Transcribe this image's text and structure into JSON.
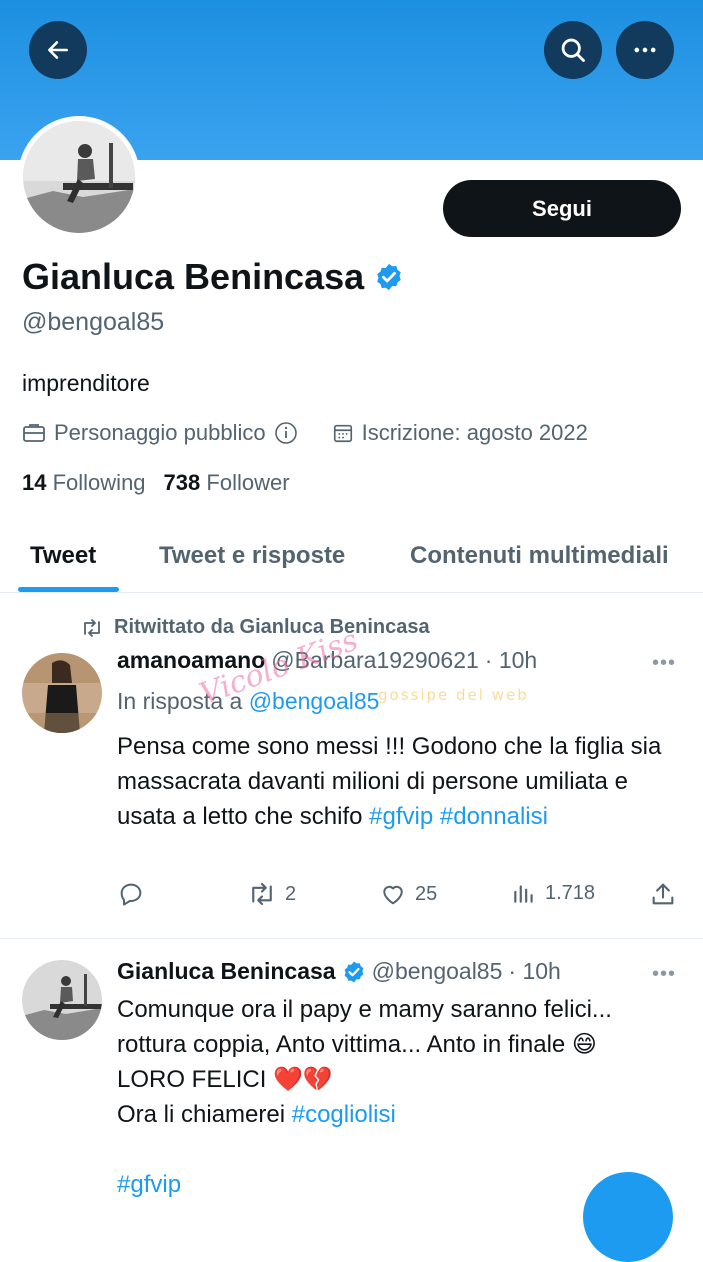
{
  "header": {
    "back_icon": "arrow-left-icon",
    "search_icon": "search-icon",
    "more_icon": "more-horizontal-icon",
    "banner_color": "#1d8fe0"
  },
  "profile": {
    "name": "Gianluca Benincasa",
    "handle": "@bengoal85",
    "verified": true,
    "follow_label": "Segui",
    "bio": "imprenditore",
    "category": "Personaggio pubblico",
    "joined": "Iscrizione: agosto 2022",
    "following_count": "14",
    "following_label": "Following",
    "follower_count": "738",
    "follower_label": "Follower"
  },
  "tabs": [
    {
      "label": "Tweet",
      "active": true
    },
    {
      "label": "Tweet e risposte",
      "active": false
    },
    {
      "label": "Contenuti multimediali",
      "active": false
    }
  ],
  "tweets": [
    {
      "retweet_label": "Ritwittato da Gianluca Benincasa",
      "name": "amanoamano",
      "handle": "@Barbara19290621",
      "time": "· 10h",
      "reply_prefix": "In risposta a",
      "reply_to": "@bengoal85",
      "text": "Pensa come sono messi !!! Godono che la figlia sia massacrata davanti milioni di persone umiliata e usata a letto che schifo",
      "hashtags": [
        "#gfvip",
        "#donnalisi"
      ],
      "replies": "",
      "retweets": "2",
      "likes": "25",
      "views": "1.718"
    },
    {
      "name": "Gianluca Benincasa",
      "handle": "@bengoal85",
      "time": "· 10h",
      "line1": "Comunque ora  il papy e mamy saranno felici...",
      "line2": "rottura coppia, Anto vittima... Anto in finale 😄",
      "line3": "LORO FELICI ❤️💔",
      "line4_prefix": "Ora li chiamerei",
      "line4_tag": "#cogliolisi",
      "hashtag": "#gfvip"
    }
  ],
  "watermark": {
    "text1": "Vicolo Kiss",
    "text2": "gossipe del web"
  },
  "colors": {
    "accent": "#1d9bf0",
    "text": "#0f1419",
    "muted": "#536471",
    "button": "#0f1419"
  }
}
